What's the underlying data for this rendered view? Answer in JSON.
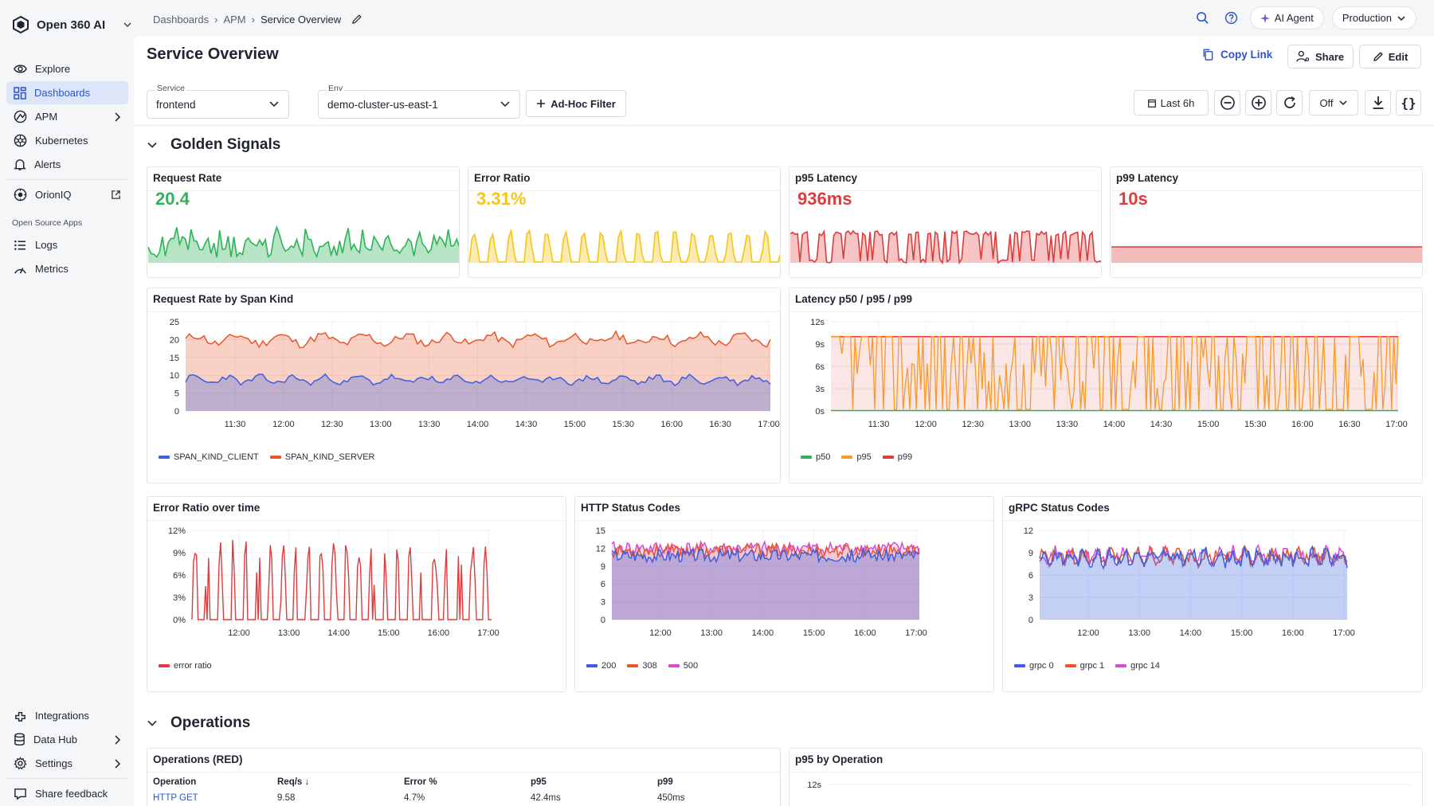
{
  "app": {
    "name": "Open 360 AI"
  },
  "sidebar": {
    "items": [
      {
        "label": "Explore",
        "icon": "eye-icon"
      },
      {
        "label": "Dashboards",
        "icon": "grid-icon",
        "active": true
      },
      {
        "label": "APM",
        "icon": "apm-icon"
      },
      {
        "label": "Kubernetes",
        "icon": "kubernetes-icon"
      },
      {
        "label": "Alerts",
        "icon": "bell-icon"
      }
    ],
    "orioniq": {
      "label": "OrionIQ",
      "icon": "orion-icon"
    },
    "section_label": "Open Source Apps",
    "oss_items": [
      {
        "label": "Logs",
        "icon": "logs-icon"
      },
      {
        "label": "Metrics",
        "icon": "metrics-icon"
      }
    ],
    "bottom_items": [
      {
        "label": "Integrations",
        "icon": "integrations-icon"
      },
      {
        "label": "Data Hub",
        "icon": "database-icon"
      },
      {
        "label": "Settings",
        "icon": "gear-icon"
      },
      {
        "label": "Share feedback",
        "icon": "feedback-icon"
      }
    ]
  },
  "breadcrumb": {
    "items": [
      "Dashboards",
      "APM",
      "Service Overview"
    ]
  },
  "topbar": {
    "ai_agent": "AI Agent",
    "environment": "Production"
  },
  "header": {
    "title": "Service Overview",
    "copy_link": "Copy Link",
    "share": "Share",
    "edit": "Edit"
  },
  "variables": {
    "service": {
      "label": "Service",
      "value": "frontend"
    },
    "env": {
      "label": "Env",
      "value": "demo-cluster-us-east-1"
    },
    "adhoc": "Ad-Hoc Filter"
  },
  "toolbar": {
    "time_range": "Last 6h",
    "refresh_interval": "Off"
  },
  "sections": {
    "golden": "Golden Signals",
    "operations": "Operations"
  },
  "colors": {
    "green": "#2fb35a",
    "yellow": "#f5c518",
    "red": "#e03b3b",
    "blue": "#3a5fe0",
    "orange": "#e8572a",
    "magenta": "#d64bd6",
    "accent": "#2f54c9"
  },
  "stats": [
    {
      "title": "Request Rate",
      "value": "20.4",
      "color": "#2fb35a"
    },
    {
      "title": "Error Ratio",
      "value": "3.31%",
      "color": "#f5c518"
    },
    {
      "title": "p95 Latency",
      "value": "936ms",
      "color": "#e03b3b"
    },
    {
      "title": "p99 Latency",
      "value": "10s",
      "color": "#e03b3b"
    }
  ],
  "chart_data": [
    {
      "title": "Request Rate by Span Kind",
      "type": "area",
      "x_ticks": [
        "11:30",
        "12:00",
        "12:30",
        "13:00",
        "13:30",
        "14:00",
        "14:30",
        "15:00",
        "15:30",
        "16:00",
        "16:30",
        "17:00"
      ],
      "y_ticks": [
        "0",
        "5",
        "10",
        "15",
        "20",
        "25"
      ],
      "ylim": [
        0,
        25
      ],
      "stacked": true,
      "series": [
        {
          "name": "SPAN_KIND_CLIENT",
          "color": "#3a5fe0",
          "approx_value": 9
        },
        {
          "name": "SPAN_KIND_SERVER",
          "color": "#e8572a",
          "approx_value": 20
        }
      ]
    },
    {
      "title": "Latency p50 / p95 / p99",
      "type": "line",
      "x_ticks": [
        "11:30",
        "12:00",
        "12:30",
        "13:00",
        "13:30",
        "14:00",
        "14:30",
        "15:00",
        "15:30",
        "16:00",
        "16:30",
        "17:00"
      ],
      "y_ticks": [
        "0s",
        "3s",
        "6s",
        "9s",
        "12s"
      ],
      "ylim": [
        0,
        12
      ],
      "series": [
        {
          "name": "p50",
          "color": "#2fb35a",
          "approx_value": 0
        },
        {
          "name": "p95",
          "color": "#f79a2a",
          "approx_range": [
            0,
            10
          ]
        },
        {
          "name": "p99",
          "color": "#e03b3b",
          "approx_value": 10
        }
      ]
    },
    {
      "title": "Error Ratio over time",
      "type": "line",
      "x_ticks": [
        "12:00",
        "13:00",
        "14:00",
        "15:00",
        "16:00",
        "17:00"
      ],
      "y_ticks": [
        "0%",
        "3%",
        "6%",
        "9%",
        "12%"
      ],
      "ylim": [
        0,
        12
      ],
      "series": [
        {
          "name": "error ratio",
          "color": "#e03b3b",
          "approx_range": [
            0,
            10
          ]
        }
      ]
    },
    {
      "title": "HTTP Status Codes",
      "type": "area",
      "x_ticks": [
        "12:00",
        "13:00",
        "14:00",
        "15:00",
        "16:00",
        "17:00"
      ],
      "y_ticks": [
        "0",
        "3",
        "6",
        "9",
        "12",
        "15"
      ],
      "ylim": [
        0,
        15
      ],
      "series": [
        {
          "name": "200",
          "color": "#3a5fe0",
          "approx_value": 11
        },
        {
          "name": "308",
          "color": "#e8572a",
          "approx_value": 12
        },
        {
          "name": "500",
          "color": "#d64bd6",
          "approx_value": 12
        }
      ]
    },
    {
      "title": "gRPC Status Codes",
      "type": "area",
      "x_ticks": [
        "12:00",
        "13:00",
        "14:00",
        "15:00",
        "16:00",
        "17:00"
      ],
      "y_ticks": [
        "0",
        "3",
        "6",
        "9",
        "12"
      ],
      "ylim": [
        0,
        12
      ],
      "series": [
        {
          "name": "grpc 0",
          "color": "#3a5fe0",
          "approx_value": 8.5
        },
        {
          "name": "grpc 1",
          "color": "#e8572a",
          "approx_value": 8.5
        },
        {
          "name": "grpc 14",
          "color": "#d64bd6",
          "approx_value": 8.5
        }
      ]
    }
  ],
  "operations": {
    "table_title": "Operations (RED)",
    "columns": [
      "Operation",
      "Req/s",
      "Error %",
      "p95",
      "p99"
    ],
    "rows": [
      [
        "HTTP GET",
        "9.58",
        "4.7%",
        "42.4ms",
        "450ms"
      ]
    ]
  },
  "p95_by_operation": {
    "title": "p95 by Operation",
    "y_ticks": [
      "12s"
    ]
  }
}
